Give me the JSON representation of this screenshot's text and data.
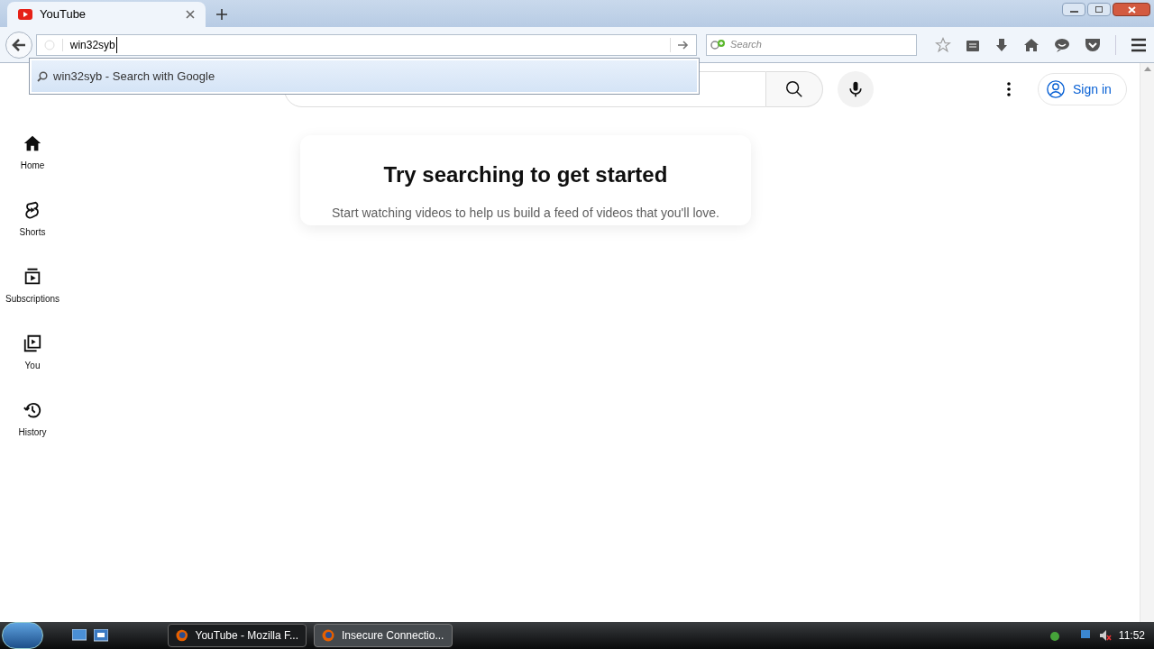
{
  "browser": {
    "tabs": [
      {
        "title": "YouTube",
        "selected": true
      }
    ],
    "address": {
      "value": "win32syb"
    },
    "suggestions": [
      {
        "text": "win32syb - Search with Google",
        "selected": true
      }
    ],
    "search": {
      "placeholder": "Search"
    }
  },
  "page": {
    "sign_in": "Sign in",
    "sidebar": [
      {
        "kind": "home",
        "label": "Home"
      },
      {
        "kind": "shorts",
        "label": "Shorts"
      },
      {
        "kind": "subscriptions",
        "label": "Subscriptions"
      },
      {
        "kind": "you",
        "label": "You"
      },
      {
        "kind": "history",
        "label": "History"
      }
    ],
    "card": {
      "title": "Try searching to get started",
      "text": "Start watching videos to help us build a feed of videos that you'll love."
    }
  },
  "taskbar": {
    "windows": [
      {
        "title": "YouTube - Mozilla F...",
        "selected": true
      },
      {
        "title": "Insecure Connectio...",
        "selected": false
      }
    ],
    "clock": "11:52"
  }
}
